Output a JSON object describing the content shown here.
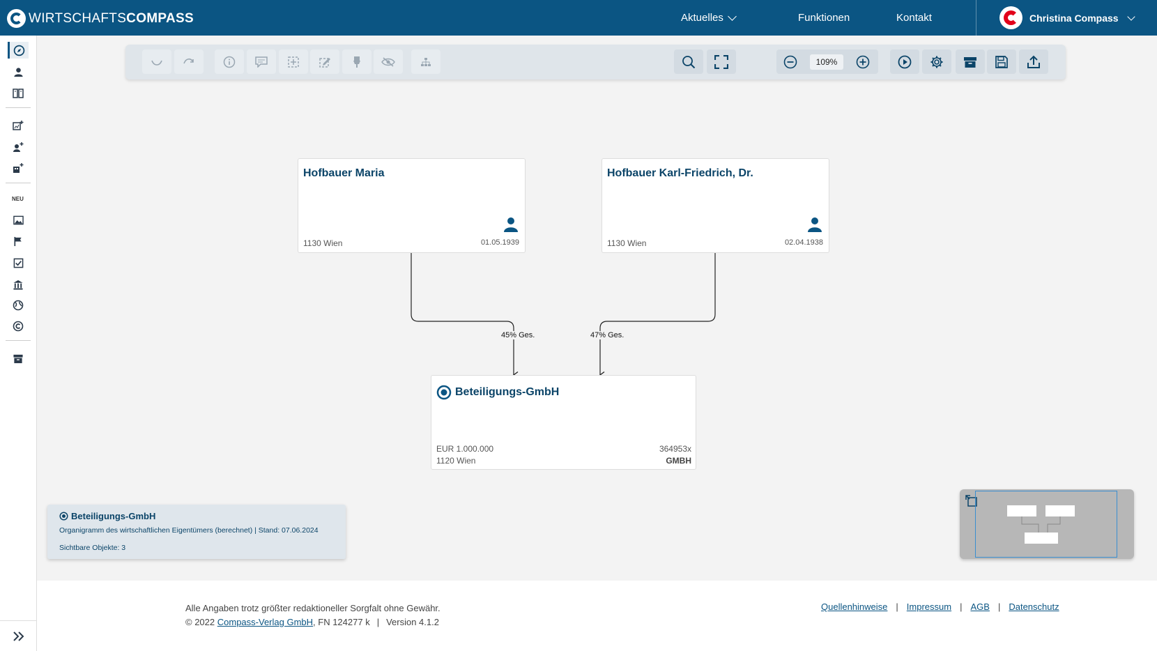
{
  "header": {
    "brand_light": "WIRTSCHAFTS",
    "brand_bold": "COMPASS",
    "nav": [
      {
        "label": "Aktuelles"
      },
      {
        "label": "Funktionen"
      },
      {
        "label": "Kontakt"
      }
    ],
    "user_name": "Christina Compass",
    "accent": "#0b5583",
    "user_logo_color": "#e2001a"
  },
  "sidebar": {
    "items_top": [
      "compass-icon",
      "person-icon",
      "book-icon"
    ],
    "items_add": [
      "add-chart-icon",
      "add-person-icon",
      "add-company-icon"
    ],
    "neu_label": "NEU",
    "items_neu": [
      "image-icon",
      "flag-icon",
      "checkbox-icon",
      "bank-icon",
      "globe-icon",
      "copyright-icon"
    ],
    "items_bottom": [
      "archive-icon"
    ]
  },
  "toolbar": {
    "zoom": "109%"
  },
  "nodes": {
    "person1": {
      "name": "Hofbauer Maria",
      "city": "1130 Wien",
      "date": "01.05.1939"
    },
    "person2": {
      "name": "Hofbauer Karl-Friedrich, Dr.",
      "city": "1130 Wien",
      "date": "02.04.1938"
    },
    "company": {
      "name": "Beteiligungs-GmbH",
      "capital": "EUR 1.000.000",
      "city": "1120 Wien",
      "fn": "364953x",
      "legal_form": "GMBH"
    }
  },
  "edges": {
    "e1": "45% Ges.",
    "e2": "47% Ges."
  },
  "info_panel": {
    "title": "Beteiligungs-GmbH",
    "subtitle": "Organigramm des wirtschaftlichen Eigentümers (berechnet) | Stand: 07.06.2024",
    "count": "Sichtbare Objekte: 3"
  },
  "footer": {
    "disclaimer": "Alle Angaben trotz größter redaktioneller Sorgfalt ohne Gewähr.",
    "copyright": "© 2022",
    "company_link": "Compass-Verlag GmbH",
    "fn": ", FN 124277 k",
    "version": "Version 4.1.2",
    "links": [
      "Quellenhinweise",
      "Impressum",
      "AGB",
      "Datenschutz"
    ]
  }
}
